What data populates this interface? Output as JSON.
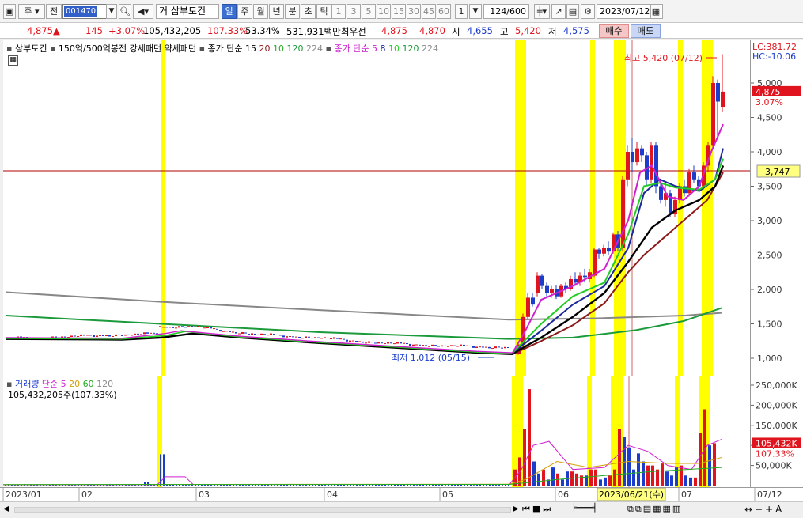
{
  "toolbar": {
    "type_label": "주",
    "prev_label": "전",
    "code": "001470",
    "name": "삼부토건",
    "name_prefix": "거",
    "periods": [
      "일",
      "주",
      "월",
      "년",
      "분",
      "초",
      "틱"
    ],
    "selected_period": "일",
    "intervals": [
      "1",
      "3",
      "5",
      "10",
      "15",
      "30",
      "45",
      "60"
    ],
    "count": "1",
    "page": "124/600",
    "date": "2023/07/12"
  },
  "quote": {
    "price": "4,875",
    "arrow": "▲",
    "change": "145",
    "change_pct": "+3.07%",
    "volume": "105,432,205",
    "volume_ratio": "107.33%",
    "turnover": "53.34%",
    "amount": "531,931백만",
    "best_label": "최우선",
    "ask": "4,875",
    "bid": "4,870",
    "open_label": "시",
    "open": "4,655",
    "high_label": "고",
    "high": "5,420",
    "low_label": "저",
    "low": "4,575",
    "buy_label": "매수",
    "sell_label": "매도"
  },
  "main_legend": {
    "name": "삼부토건",
    "pattern_text": "150억/500억봉전 강세패턴",
    "weak_pattern": "약세패턴",
    "ma_close_label": "종가 단순",
    "ma_close_periods": [
      "15",
      "20",
      "10",
      "120",
      "224"
    ],
    "ma_close2_label": "종가 단순",
    "ma_close2_periods": [
      "5",
      "8",
      "10",
      "120",
      "224"
    ]
  },
  "annotations": {
    "high": "최고 5,420 (07/12)",
    "low": "최저 1,012 (05/15)",
    "lc": "LC:381.72",
    "hc": "HC:-10.06",
    "last_price": "4,875",
    "last_pct": "3.07%",
    "crosshair_price": "3,747",
    "crosshair_date": "2023/06/21(수)"
  },
  "price_axis": [
    "5,000",
    "4,500",
    "4,000",
    "3,500",
    "3,000",
    "2,500",
    "2,000",
    "1,500",
    "1,000"
  ],
  "vol_legend": {
    "label": "거래량",
    "ma_label": "단순",
    "periods": [
      "5",
      "20",
      "60",
      "120"
    ],
    "value": "105,432,205주(107.33%)"
  },
  "vol_axis": [
    "250,000K",
    "200,000K",
    "150,000K",
    "100,000K",
    "50,000K"
  ],
  "vol_last": "105,432K",
  "vol_last_pct": "107.33%",
  "date_axis": [
    "2023/01",
    "02",
    "03",
    "04",
    "05",
    "06",
    "07",
    "07/12"
  ],
  "colors": {
    "up": "#e0141e",
    "down": "#1c3ccc",
    "highlight": "#ffff00",
    "ma5": "#d020d0",
    "ma10": "#22cc22",
    "ma15": "#1a2a9a",
    "ma20": "#000000",
    "ma60": "#8b1a1a",
    "ma120": "#1a9a3a",
    "ma224": "#888888"
  }
}
